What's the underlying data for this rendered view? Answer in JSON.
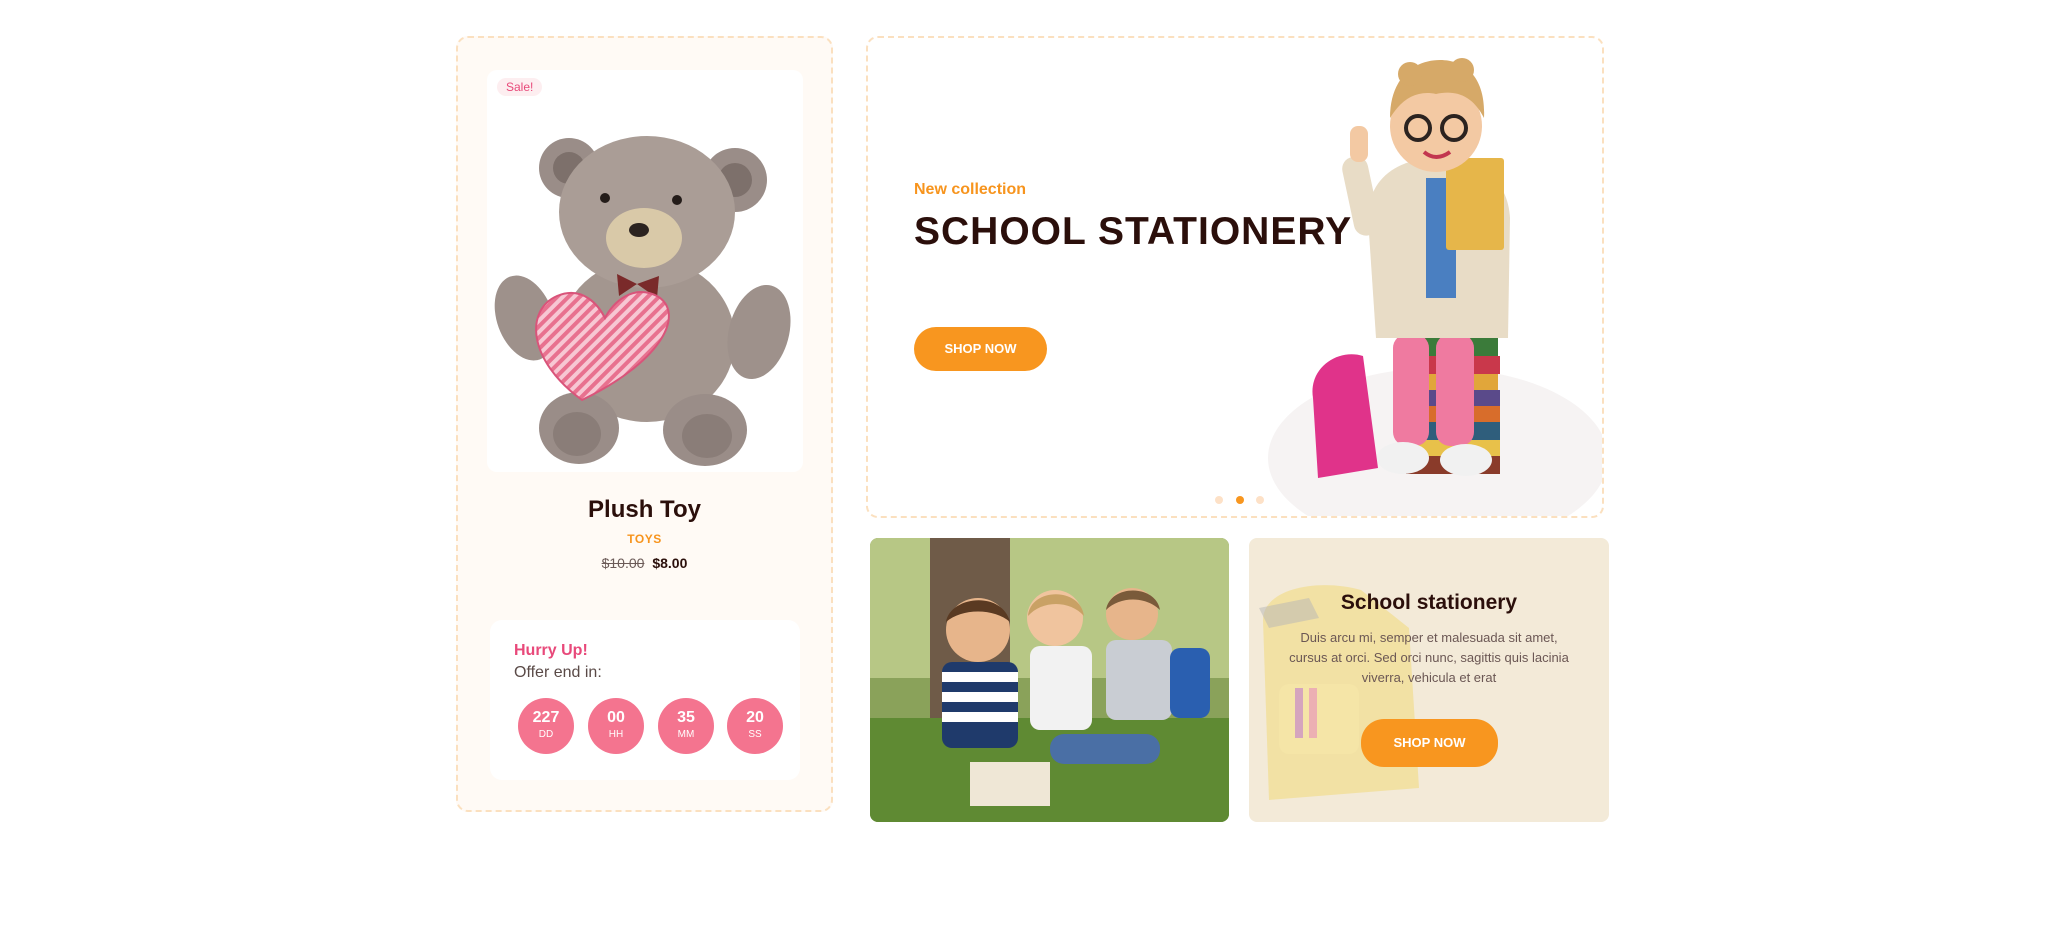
{
  "product": {
    "sale_badge": "Sale!",
    "title": "Plush Toy",
    "category": "TOYS",
    "old_price": "$10.00",
    "new_price": "$8.00",
    "image_icon": "teddy-bear-icon"
  },
  "countdown": {
    "hurry": "Hurry Up!",
    "offer": "Offer end in:",
    "units": [
      {
        "value": "227",
        "label": "DD"
      },
      {
        "value": "00",
        "label": "HH"
      },
      {
        "value": "35",
        "label": "MM"
      },
      {
        "value": "20",
        "label": "SS"
      }
    ]
  },
  "hero": {
    "subtitle": "New collection",
    "title": "SCHOOL STATIONERY",
    "button": "SHOP NOW",
    "slide_dots": 3,
    "active_slide": 2
  },
  "promo": {
    "title": "School stationery",
    "text": "Duis arcu mi, semper et malesuada sit amet, cursus at orci. Sed orci nunc, sagittis quis lacinia viverra, vehicula et erat",
    "button": "SHOP NOW"
  },
  "colors": {
    "accent": "#f8961f",
    "pink": "#e8497a",
    "countdown_circle": "#f4748f",
    "dark_text": "#2b0f0b",
    "dashed_border": "#fbe0bf"
  }
}
